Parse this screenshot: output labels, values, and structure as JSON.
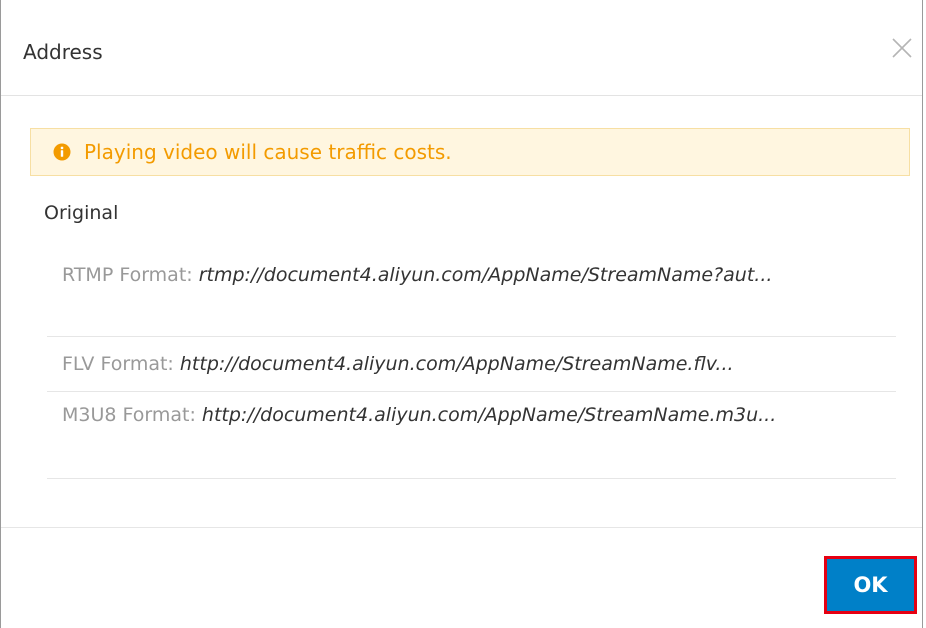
{
  "dialog": {
    "title": "Address",
    "close_icon": "close-icon",
    "alert": {
      "icon": "info-circle-icon",
      "text": "Playing video will cause traffic costs.",
      "color": "#f39b00",
      "background": "#fff6e0"
    },
    "section_title": "Original",
    "formats": [
      {
        "label": "RTMP Format:",
        "url": "rtmp://document4.aliyun.com/AppName/StreamName?aut..."
      },
      {
        "label": "FLV Format:",
        "url": "http://document4.aliyun.com/AppName/StreamName.flv..."
      },
      {
        "label": "M3U8 Format:",
        "url": "http://document4.aliyun.com/AppName/StreamName.m3u..."
      }
    ],
    "ok_label": "OK",
    "ok_color": "#0080c8",
    "highlight_color": "#e60012"
  }
}
